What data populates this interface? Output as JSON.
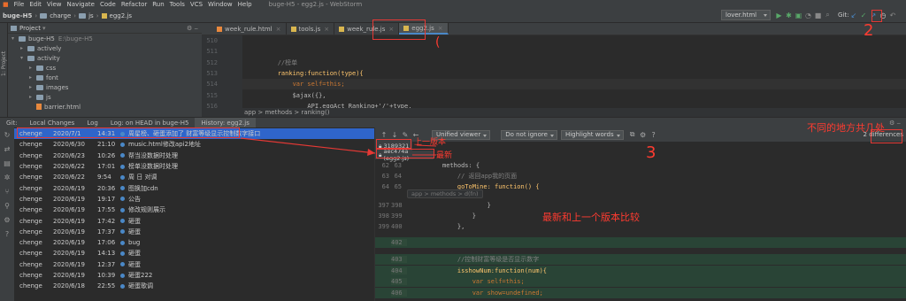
{
  "menubar": {
    "items": [
      "File",
      "Edit",
      "View",
      "Navigate",
      "Code",
      "Refactor",
      "Run",
      "Tools",
      "VCS",
      "Window",
      "Help"
    ],
    "title": "buge-H5 - egg2.js - WebStorm"
  },
  "navbar": {
    "crumbs": [
      "buge-H5",
      "charge",
      "js",
      "egg2.js"
    ],
    "run_config": "lover.html",
    "git_label": "Git:"
  },
  "side_strip": {
    "label": "1: Project"
  },
  "project": {
    "header": "Project",
    "tree": [
      {
        "indent": 0,
        "label": "buge-H5",
        "extra": "E:\\buge-H5",
        "open": true
      },
      {
        "indent": 1,
        "label": "actively",
        "open": false
      },
      {
        "indent": 1,
        "label": "activity",
        "open": true
      },
      {
        "indent": 2,
        "label": "css",
        "open": false
      },
      {
        "indent": 2,
        "label": "font",
        "open": false
      },
      {
        "indent": 2,
        "label": "images",
        "open": false
      },
      {
        "indent": 2,
        "label": "js",
        "open": false
      },
      {
        "indent": 2,
        "label": "barrier.html",
        "file": true
      }
    ]
  },
  "editor": {
    "tabs": [
      {
        "label": "week_rule.html",
        "active": false
      },
      {
        "label": "tools.js",
        "active": false
      },
      {
        "label": "week_rule.js",
        "active": false
      },
      {
        "label": "egg2.js",
        "active": true
      }
    ],
    "lines": [
      {
        "n": "510",
        "code": "",
        "type": "plain"
      },
      {
        "n": "511",
        "code": "",
        "type": "plain"
      },
      {
        "n": "512",
        "code": "        //榜单",
        "type": "comment"
      },
      {
        "n": "513",
        "code": "        ranking:function(type){",
        "type": "fnline"
      },
      {
        "n": "514",
        "code": "            var self=this;",
        "type": "var",
        "hl": true
      },
      {
        "n": "515",
        "code": "            $ajax({},",
        "type": "plain"
      },
      {
        "n": "516",
        "code": "                API.eggAct_Ranking+'/'+type,",
        "type": "plain"
      }
    ],
    "breadcrumb": "app  >  methods  >  ranking()"
  },
  "git_tabs": [
    "Git:",
    "Local Changes",
    "Log",
    "Log: on HEAD in buge-H5",
    "History: egg2.js"
  ],
  "commits": [
    {
      "author": "chenge",
      "date": "2020/7/1",
      "time": "14:31",
      "msg": "周星榜、砸蛋添加了 财富等级显示控制数字接口",
      "selected": true
    },
    {
      "author": "chenge",
      "date": "2020/6/30",
      "time": "21:10",
      "msg": "music.html修改api2地址"
    },
    {
      "author": "chenge",
      "date": "2020/6/23",
      "time": "10:26",
      "msg": "帮当没数据时处理"
    },
    {
      "author": "chenge",
      "date": "2020/6/22",
      "time": "17:01",
      "msg": "榜单没数据时处理"
    },
    {
      "author": "chenge",
      "date": "2020/6/22",
      "time": "9:54",
      "msg": "周 日 对调"
    },
    {
      "author": "chenge",
      "date": "2020/6/19",
      "time": "20:36",
      "msg": "图换加cdn"
    },
    {
      "author": "chenge",
      "date": "2020/6/19",
      "time": "19:17",
      "msg": "公告"
    },
    {
      "author": "chenge",
      "date": "2020/6/19",
      "time": "17:55",
      "msg": "修改规则展示"
    },
    {
      "author": "chenge",
      "date": "2020/6/19",
      "time": "17:42",
      "msg": "砸蛋"
    },
    {
      "author": "chenge",
      "date": "2020/6/19",
      "time": "17:37",
      "msg": "砸蛋"
    },
    {
      "author": "chenge",
      "date": "2020/6/19",
      "time": "17:06",
      "msg": "bug"
    },
    {
      "author": "chenge",
      "date": "2020/6/19",
      "time": "14:13",
      "msg": "砸蛋"
    },
    {
      "author": "chenge",
      "date": "2020/6/19",
      "time": "12:37",
      "msg": "砸蛋"
    },
    {
      "author": "chenge",
      "date": "2020/6/19",
      "time": "10:39",
      "msg": "砸蛋222"
    },
    {
      "author": "chenge",
      "date": "2020/6/18",
      "time": "22:55",
      "msg": "砸蛋歌调"
    }
  ],
  "diff": {
    "viewer": "Unified viewer",
    "ignore": "Do not ignore",
    "highlight": "Highlight words",
    "differences": "2 differences",
    "rev_old": "3189321",
    "rev_new": "aec474a (egg2.js)",
    "collapsed": "app > methods > d(fn)",
    "lines": [
      {
        "a": "62",
        "b": "63",
        "code": "methods: {",
        "type": "plain"
      },
      {
        "a": "63",
        "b": "64",
        "code": "    // 返回app我的页面",
        "type": "comment"
      },
      {
        "a": "64",
        "b": "65",
        "code": "    goToMine: function() {",
        "type": "fnline"
      },
      {
        "a": "397",
        "b": "398",
        "code": "            }",
        "type": "plain"
      },
      {
        "a": "398",
        "b": "399",
        "code": "        }",
        "type": "plain"
      },
      {
        "a": "399",
        "b": "400",
        "code": "    },",
        "type": "plain"
      },
      {
        "a": "",
        "b": "402",
        "code": "",
        "type": "added"
      },
      {
        "a": "",
        "b": "403",
        "code": "    //控制财富等级是否显示数字",
        "type": "addcomment"
      },
      {
        "a": "",
        "b": "404",
        "code": "    isshowNum:function(num){",
        "type": "addfn"
      },
      {
        "a": "",
        "b": "405",
        "code": "        var self=this;",
        "type": "addvar"
      },
      {
        "a": "",
        "b": "406",
        "code": "        var show=undefined;",
        "type": "addvar"
      }
    ]
  },
  "annotations": {
    "old_version": "上一版本",
    "latest": "最新",
    "compare_note": "最新和上一个版本比较",
    "diff_count_note": "不同的地方共几处",
    "mark_2": "2",
    "mark_3": "3"
  }
}
